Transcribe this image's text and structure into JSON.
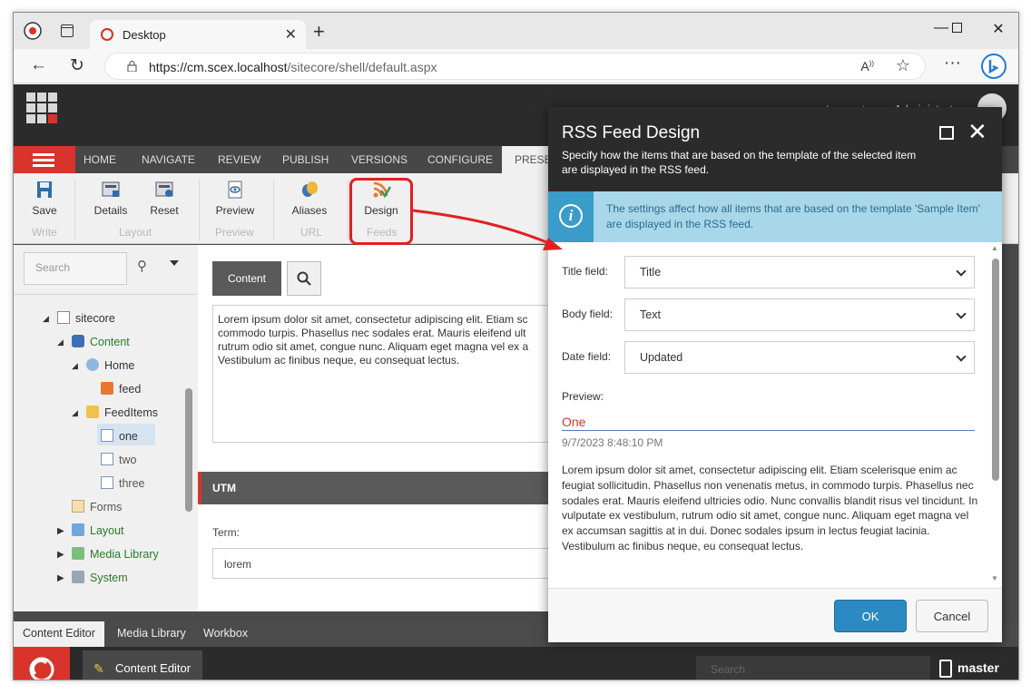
{
  "browser": {
    "tab_title": "Desktop",
    "url_host": "https://cm.scex.localhost",
    "url_path": "/sitecore/shell/default.aspx",
    "window_controls": [
      "minimize-icon",
      "maximize-icon",
      "close-icon"
    ]
  },
  "sitecore": {
    "header": {
      "logout": "Log out",
      "user": "Administrator"
    },
    "ribbon_tabs": [
      "HOME",
      "NAVIGATE",
      "REVIEW",
      "PUBLISH",
      "VERSIONS",
      "CONFIGURE",
      "PRESEN"
    ],
    "ribbon_buttons": {
      "save": "Save",
      "details": "Details",
      "reset": "Reset",
      "preview": "Preview",
      "aliases": "Aliases",
      "design": "Design"
    },
    "ribbon_groups": {
      "write": "Write",
      "layout": "Layout",
      "preview": "Preview",
      "url": "URL",
      "feeds": "Feeds"
    },
    "search_placeholder": "Search",
    "tree": {
      "sitecore": "sitecore",
      "content": "Content",
      "home": "Home",
      "feed": "feed",
      "feeditems": "FeedItems",
      "one": "one",
      "two": "two",
      "three": "three",
      "forms": "Forms",
      "layout": "Layout",
      "media_library": "Media Library",
      "system": "System"
    },
    "editor": {
      "content_tab": "Content",
      "rich_text": "Lorem ipsum dolor sit amet, consectetur adipiscing elit. Etiam sc commodo turpis. Phasellus nec sodales erat. Mauris eleifend ult rutrum odio sit amet, congue nunc. Aliquam eget magna vel ex a Vestibulum ac finibus neque, eu consequat lectus.",
      "section": "UTM",
      "term_label": "Term:",
      "term_value": "lorem"
    },
    "bottom_tabs": {
      "content_editor": "Content Editor",
      "media_library": "Media Library",
      "workbox": "Workbox"
    },
    "taskbar": {
      "item": "Content Editor",
      "search": "Search",
      "database": "master"
    }
  },
  "dialog": {
    "title": "RSS Feed Design",
    "subtitle": "Specify how the items that are based on the template of the selected item are displayed in the RSS feed.",
    "info": "The settings affect how all items that are based on the template 'Sample Item' are displayed in the RSS feed.",
    "fields": {
      "title_label": "Title field:",
      "title_value": "Title",
      "body_label": "Body field:",
      "body_value": "Text",
      "date_label": "Date field:",
      "date_value": "Updated"
    },
    "preview": {
      "label": "Preview:",
      "item_title": "One",
      "date": "9/7/2023 8:48:10 PM",
      "body": "Lorem ipsum dolor sit amet, consectetur adipiscing elit. Etiam scelerisque enim ac feugiat sollicitudin. Phasellus non venenatis metus, in commodo turpis. Phasellus nec sodales erat. Mauris eleifend ultricies odio. Nunc convallis blandit risus vel tincidunt. In vulputate ex vestibulum, rutrum odio sit amet, congue nunc. Aliquam eget magna vel ex accumsan sagittis at in dui. Donec sodales ipsum in lectus feugiat lacinia. Vestibulum ac finibus neque, eu consequat lectus."
    },
    "ok": "OK",
    "cancel": "Cancel"
  },
  "colors": {
    "accent_red": "#d9342b",
    "primary_blue": "#2b8ac2",
    "info_bg": "#a8d7ea",
    "annotation_red": "#e02020"
  }
}
